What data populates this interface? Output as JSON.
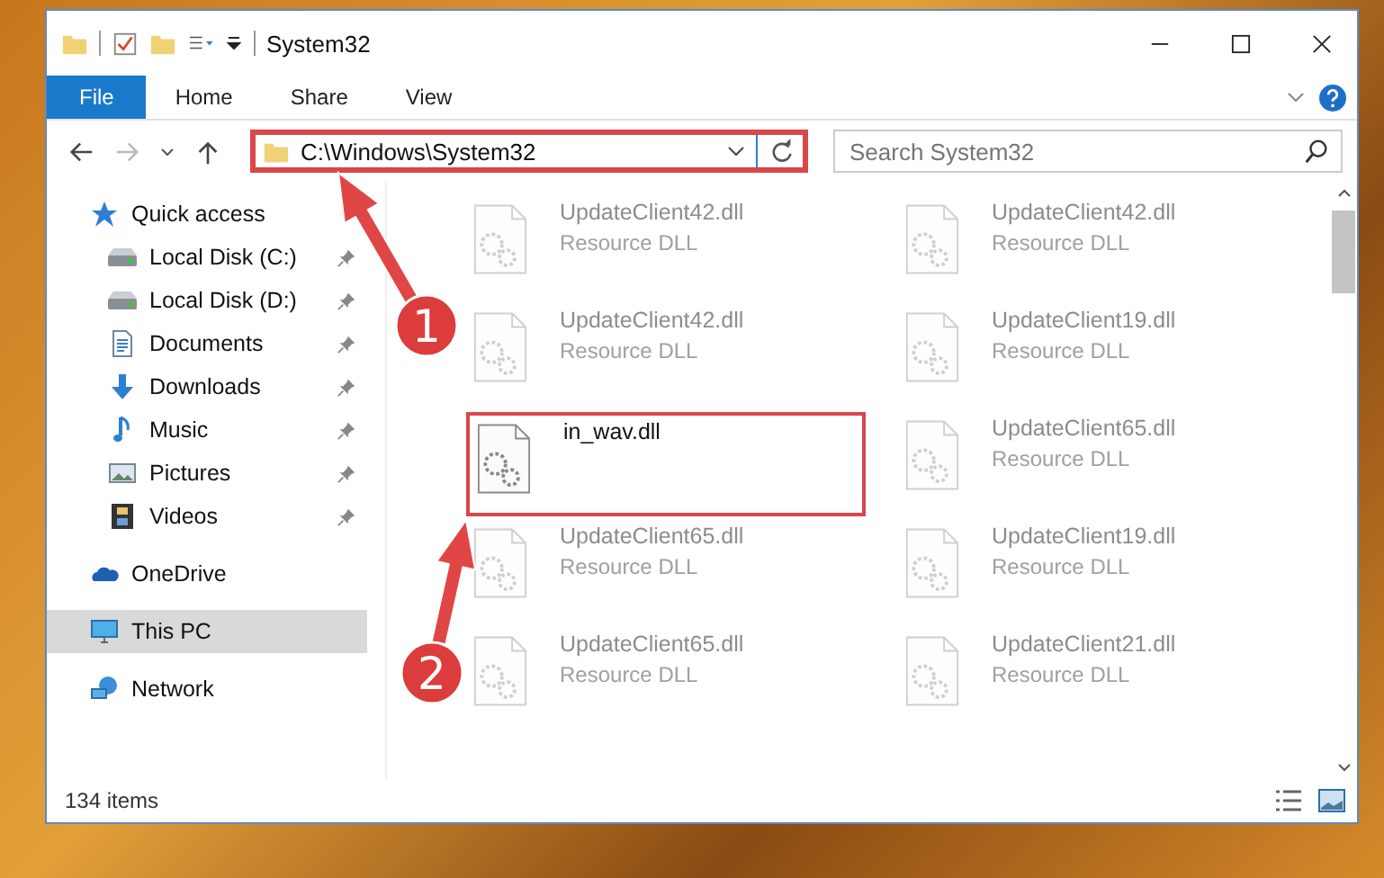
{
  "window": {
    "title": "System32"
  },
  "ribbon": {
    "tabs": [
      {
        "label": "File",
        "selected": true
      },
      {
        "label": "Home",
        "selected": false
      },
      {
        "label": "Share",
        "selected": false
      },
      {
        "label": "View",
        "selected": false
      }
    ]
  },
  "address_bar": {
    "path": "C:\\Windows\\System32",
    "highlighted": true
  },
  "search": {
    "placeholder": "Search System32"
  },
  "sidebar": {
    "items": [
      {
        "label": "Quick access",
        "kind": "star",
        "selected": false,
        "children": [
          {
            "label": "Local Disk (C:)",
            "kind": "drive",
            "pinned": true
          },
          {
            "label": "Local Disk (D:)",
            "kind": "drive",
            "pinned": true
          },
          {
            "label": "Documents",
            "kind": "document",
            "pinned": true
          },
          {
            "label": "Downloads",
            "kind": "download",
            "pinned": true
          },
          {
            "label": "Music",
            "kind": "music",
            "pinned": true
          },
          {
            "label": "Pictures",
            "kind": "picture",
            "pinned": true
          },
          {
            "label": "Videos",
            "kind": "video",
            "pinned": true
          }
        ]
      },
      {
        "label": "OneDrive",
        "kind": "cloud",
        "selected": false
      },
      {
        "label": "This PC",
        "kind": "computer",
        "selected": true
      },
      {
        "label": "Network",
        "kind": "network",
        "selected": false
      }
    ]
  },
  "files": [
    {
      "name": "UpdateClient42.dll",
      "type": "Resource DLL",
      "highlighted": false
    },
    {
      "name": "UpdateClient42.dll",
      "type": "Resource DLL",
      "highlighted": false
    },
    {
      "name": "UpdateClient42.dll",
      "type": "Resource DLL",
      "highlighted": false
    },
    {
      "name": "UpdateClient19.dll",
      "type": "Resource DLL",
      "highlighted": false
    },
    {
      "name": "in_wav.dll",
      "highlighted": true
    },
    {
      "name": "UpdateClient65.dll",
      "type": "Resource DLL",
      "highlighted": false
    },
    {
      "name": "UpdateClient65.dll",
      "type": "Resource DLL",
      "highlighted": false
    },
    {
      "name": "UpdateClient19.dll",
      "type": "Resource DLL",
      "highlighted": false
    },
    {
      "name": "UpdateClient65.dll",
      "type": "Resource DLL",
      "highlighted": false
    },
    {
      "name": "UpdateClient21.dll",
      "type": "Resource DLL",
      "highlighted": false
    }
  ],
  "annotations": [
    {
      "label": "1"
    },
    {
      "label": "2"
    }
  ],
  "status_bar": {
    "item_count": "134 items"
  }
}
